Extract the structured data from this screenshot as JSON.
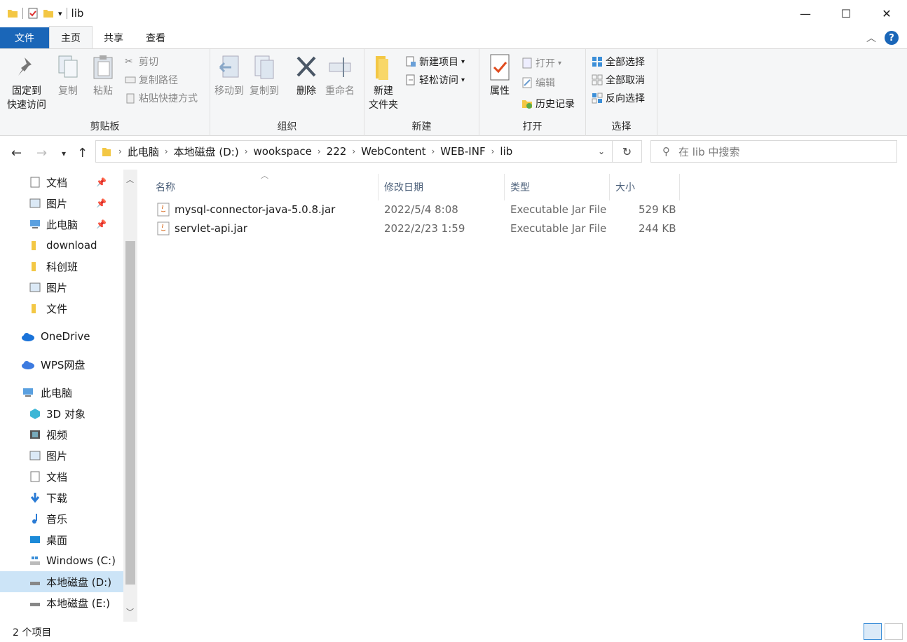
{
  "window": {
    "title": "lib"
  },
  "ribbon_tabs": [
    {
      "label": "文件"
    },
    {
      "label": "主页"
    },
    {
      "label": "共享"
    },
    {
      "label": "查看"
    }
  ],
  "ribbon": {
    "clipboard": {
      "label": "剪贴板",
      "pin": "固定到",
      "pin2": "快速访问",
      "copy": "复制",
      "paste": "粘贴",
      "cut": "剪切",
      "copy_path": "复制路径",
      "paste_shortcut": "粘贴快捷方式"
    },
    "organize": {
      "label": "组织",
      "move_to": "移动到",
      "copy_to": "复制到",
      "delete": "删除",
      "rename": "重命名"
    },
    "new": {
      "label": "新建",
      "new_folder": "新建",
      "new_folder2": "文件夹",
      "new_item": "新建项目",
      "easy_access": "轻松访问"
    },
    "open": {
      "label": "打开",
      "properties": "属性",
      "open": "打开",
      "edit": "编辑",
      "history": "历史记录"
    },
    "select": {
      "label": "选择",
      "select_all": "全部选择",
      "select_none": "全部取消",
      "invert": "反向选择"
    }
  },
  "address": {
    "crumbs": [
      "此电脑",
      "本地磁盘 (D:)",
      "wookspace",
      "222",
      "WebContent",
      "WEB-INF",
      "lib"
    ],
    "search_placeholder": "在 lib 中搜索"
  },
  "nav": {
    "items": [
      {
        "label": "文档",
        "icon": "document-icon",
        "pinned": true
      },
      {
        "label": "图片",
        "icon": "picture-icon",
        "pinned": true
      },
      {
        "label": "此电脑",
        "icon": "computer-icon",
        "pinned": true
      },
      {
        "label": "download",
        "icon": "folder-icon"
      },
      {
        "label": "科创班",
        "icon": "folder-icon"
      },
      {
        "label": "图片",
        "icon": "picture-icon"
      },
      {
        "label": "文件",
        "icon": "folder-icon"
      },
      {
        "label": "OneDrive",
        "icon": "cloud-icon"
      },
      {
        "label": "WPS网盘",
        "icon": "cloud-icon"
      },
      {
        "label": "此电脑",
        "icon": "computer-icon"
      },
      {
        "label": "3D 对象",
        "icon": "3d-objects-icon"
      },
      {
        "label": "视频",
        "icon": "video-icon"
      },
      {
        "label": "图片",
        "icon": "picture-icon"
      },
      {
        "label": "文档",
        "icon": "document-icon"
      },
      {
        "label": "下载",
        "icon": "download-icon"
      },
      {
        "label": "音乐",
        "icon": "music-icon"
      },
      {
        "label": "桌面",
        "icon": "desktop-icon"
      },
      {
        "label": "Windows (C:)",
        "icon": "drive-icon"
      },
      {
        "label": "本地磁盘 (D:)",
        "icon": "drive-icon",
        "selected": true
      },
      {
        "label": "本地磁盘 (E:)",
        "icon": "drive-icon"
      }
    ]
  },
  "columns": {
    "name": "名称",
    "date": "修改日期",
    "type": "类型",
    "size": "大小"
  },
  "files": [
    {
      "name": "mysql-connector-java-5.0.8.jar",
      "date": "2022/5/4 8:08",
      "type": "Executable Jar File",
      "size": "529 KB"
    },
    {
      "name": "servlet-api.jar",
      "date": "2022/2/23 1:59",
      "type": "Executable Jar File",
      "size": "244 KB"
    }
  ],
  "status": {
    "count": "2 个项目"
  },
  "colors": {
    "accent": "#1a66b8",
    "selection": "#cce4f7"
  }
}
